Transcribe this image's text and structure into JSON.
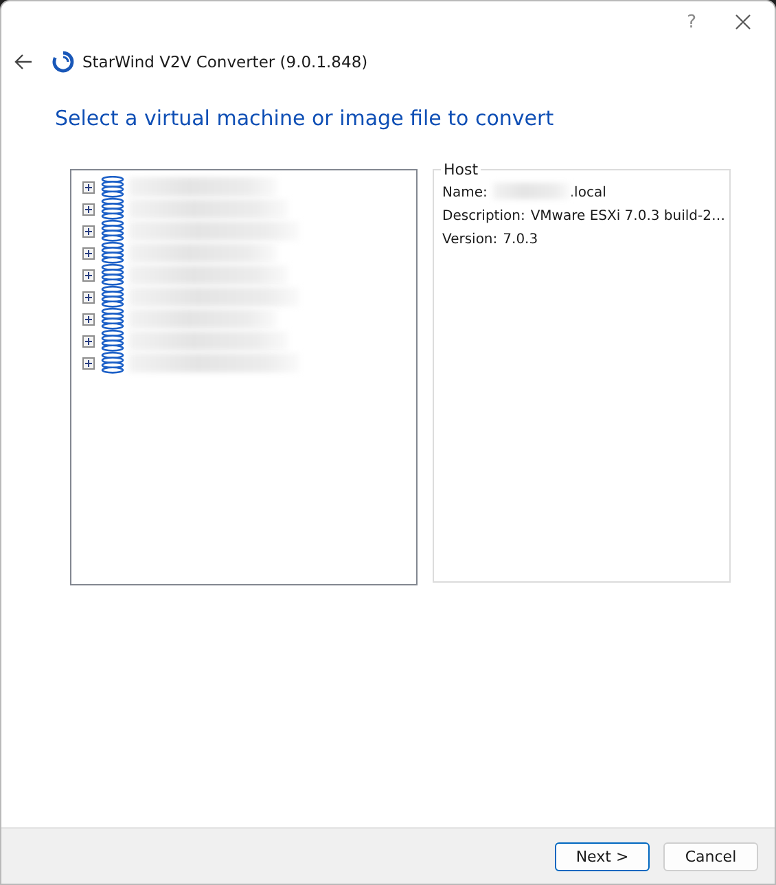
{
  "window": {
    "help": "?",
    "title": "StarWind V2V Converter (9.0.1.848)"
  },
  "heading": "Select a virtual machine or image file to convert",
  "tree": {
    "items": [
      {
        "expanded": false
      },
      {
        "expanded": false
      },
      {
        "expanded": false
      },
      {
        "expanded": false
      },
      {
        "expanded": false
      },
      {
        "expanded": false
      },
      {
        "expanded": false
      },
      {
        "expanded": false
      },
      {
        "expanded": false
      }
    ]
  },
  "details": {
    "title": "Host",
    "rows": [
      {
        "label": "Name:",
        "value": ".local",
        "redacted": true
      },
      {
        "label": "Description:",
        "value": "VMware ESXi 7.0.3 build-2…",
        "redacted": false
      },
      {
        "label": "Version:",
        "value": "7.0.3",
        "redacted": false
      }
    ]
  },
  "buttons": [
    {
      "label": "Next >",
      "kind": "primary"
    },
    {
      "label": "Cancel",
      "kind": "normal"
    }
  ]
}
